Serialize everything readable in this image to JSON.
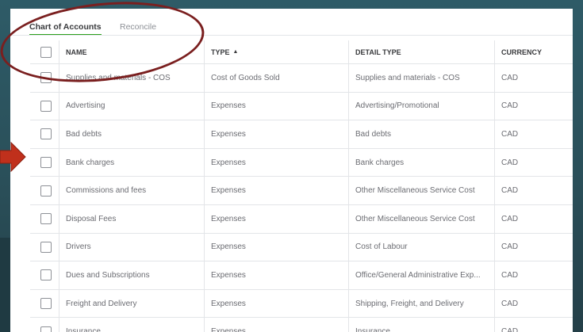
{
  "tabs": {
    "chart_of_accounts": "Chart of Accounts",
    "reconcile": "Reconcile"
  },
  "table": {
    "columns": {
      "name": "NAME",
      "type": "TYPE",
      "detail_type": "DETAIL TYPE",
      "currency": "CURRENCY"
    },
    "sort_indicator": "▲",
    "rows": [
      {
        "name": "Supplies and materials - COS",
        "type": "Cost of Goods Sold",
        "detail_type": "Supplies and materials - COS",
        "currency": "CAD"
      },
      {
        "name": "Advertising",
        "type": "Expenses",
        "detail_type": "Advertising/Promotional",
        "currency": "CAD"
      },
      {
        "name": "Bad debts",
        "type": "Expenses",
        "detail_type": "Bad debts",
        "currency": "CAD"
      },
      {
        "name": "Bank charges",
        "type": "Expenses",
        "detail_type": "Bank charges",
        "currency": "CAD"
      },
      {
        "name": "Commissions and fees",
        "type": "Expenses",
        "detail_type": "Other Miscellaneous Service Cost",
        "currency": "CAD"
      },
      {
        "name": "Disposal Fees",
        "type": "Expenses",
        "detail_type": "Other Miscellaneous Service Cost",
        "currency": "CAD"
      },
      {
        "name": "Drivers",
        "type": "Expenses",
        "detail_type": "Cost of Labour",
        "currency": "CAD"
      },
      {
        "name": "Dues and Subscriptions",
        "type": "Expenses",
        "detail_type": "Office/General Administrative Exp...",
        "currency": "CAD"
      },
      {
        "name": "Freight and Delivery",
        "type": "Expenses",
        "detail_type": "Shipping, Freight, and Delivery",
        "currency": "CAD"
      },
      {
        "name": "Insurance",
        "type": "Expenses",
        "detail_type": "Insurance",
        "currency": "CAD"
      }
    ]
  },
  "colors": {
    "active_tab_underline": "#2ca01c",
    "annotation": "#7a1f1f",
    "pointer_arrow": "#c0301c"
  },
  "icons": [
    "sort-up-icon",
    "annotation-circle",
    "pointer-arrow-icon"
  ]
}
